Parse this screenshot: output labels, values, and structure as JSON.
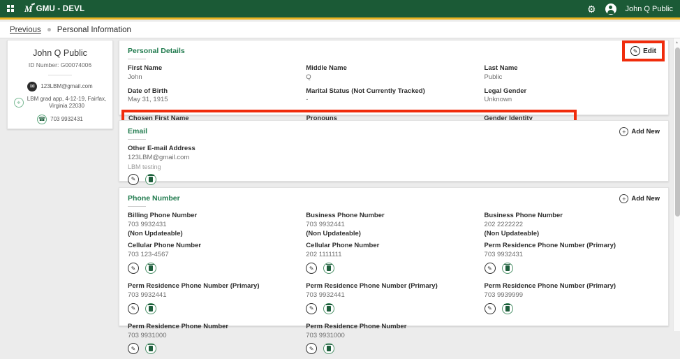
{
  "header": {
    "app_title": "GMU - DEVL",
    "user_name": "John Q Public",
    "colors": {
      "bar_green": "#1b5a36",
      "accent_gold": "#e9b322",
      "heading_green": "#1f7a4d",
      "annotation_red": "#f02c0c"
    }
  },
  "breadcrumb": {
    "previous": "Previous",
    "current": "Personal Information"
  },
  "profile_card": {
    "name": "John Q Public",
    "id_label": "ID Number: G00074006",
    "email": "123LBM@gmail.com",
    "address_line1": "LBM grad app, 4-12-19, Fairfax,",
    "address_line2": "Virginia 22030",
    "phone": "703 9932431"
  },
  "personal_details": {
    "title": "Personal Details",
    "edit_label": "Edit",
    "fields": [
      {
        "label": "First Name",
        "value": "John"
      },
      {
        "label": "Middle Name",
        "value": "Q"
      },
      {
        "label": "Last Name",
        "value": "Public"
      },
      {
        "label": "Date of Birth",
        "value": "May 31, 1915"
      },
      {
        "label": "Marital Status (Not Currently Tracked)",
        "value": "-"
      },
      {
        "label": "Legal Gender",
        "value": "Unknown"
      },
      {
        "label": "Chosen First Name",
        "value": "-"
      },
      {
        "label": "Pronouns",
        "value": "-"
      },
      {
        "label": "Gender Identity",
        "value": "-"
      }
    ]
  },
  "email_section": {
    "title": "Email",
    "add_new_label": "Add New",
    "entries": [
      {
        "label": "Other E-mail Address",
        "value": "123LBM@gmail.com",
        "note": "LBM testing"
      }
    ]
  },
  "phone_section": {
    "title": "Phone Number",
    "add_new_label": "Add New",
    "entries": [
      {
        "label": "Billing Phone Number",
        "value": "703 9932431",
        "extra": "(Non Updateable)"
      },
      {
        "label": "Business Phone Number",
        "value": "703 9932441",
        "extra": "(Non Updateable)"
      },
      {
        "label": "Business Phone Number",
        "value": "202 2222222",
        "extra": "(Non Updateable)"
      },
      {
        "label": "Cellular Phone Number",
        "value": "703 123-4567"
      },
      {
        "label": "Cellular Phone Number",
        "value": "202 1111111"
      },
      {
        "label": "Perm Residence Phone Number (Primary)",
        "value": "703 9932431"
      },
      {
        "label": "Perm Residence Phone Number (Primary)",
        "value": "703 9932441"
      },
      {
        "label": "Perm Residence Phone Number (Primary)",
        "value": "703 9932441"
      },
      {
        "label": "Perm Residence Phone Number (Primary)",
        "value": "703 9939999"
      },
      {
        "label": "Perm Residence Phone Number",
        "value": "703 9931000"
      },
      {
        "label": "Perm Residence Phone Number",
        "value": "703 9931000"
      }
    ]
  }
}
